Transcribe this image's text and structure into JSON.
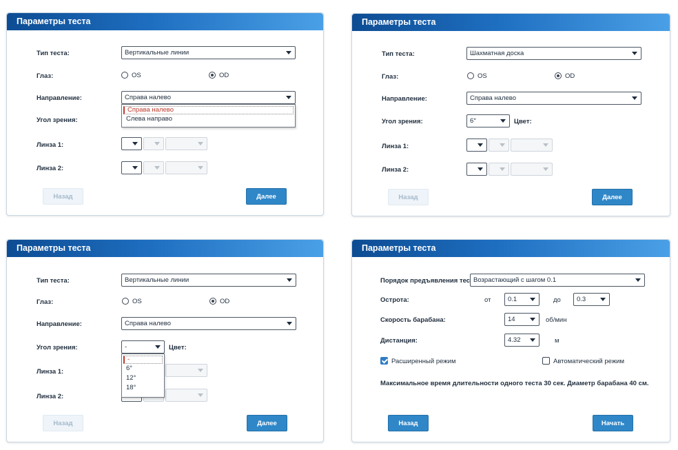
{
  "panel1": {
    "title": "Параметры теста",
    "test_type_label": "Тип теста:",
    "test_type_value": "Вертикальные линии",
    "eye_label": "Глаз:",
    "eye_os": "OS",
    "eye_od": "OD",
    "eye_selected": "OD",
    "direction_label": "Направление:",
    "direction_value": "Справа налево",
    "direction_options": [
      "Справа налево",
      "Слева направо"
    ],
    "angle_label": "Угол зрения:",
    "lens1_label": "Линза 1:",
    "lens2_label": "Линза 2:",
    "back_label": "Назад",
    "next_label": "Далее"
  },
  "panel2": {
    "title": "Параметры теста",
    "test_type_label": "Тип теста:",
    "test_type_value": "Шахматная доска",
    "eye_label": "Глаз:",
    "eye_os": "OS",
    "eye_od": "OD",
    "eye_selected": "OD",
    "direction_label": "Направление:",
    "direction_value": "Справа налево",
    "angle_label": "Угол зрения:",
    "angle_value": "6°",
    "color_label": "Цвет:",
    "lens1_label": "Линза 1:",
    "lens2_label": "Линза 2:",
    "back_label": "Назад",
    "next_label": "Далее"
  },
  "panel3": {
    "title": "Параметры теста",
    "test_type_label": "Тип теста:",
    "test_type_value": "Вертикальные линии",
    "eye_label": "Глаз:",
    "eye_os": "OS",
    "eye_od": "OD",
    "eye_selected": "OD",
    "direction_label": "Направление:",
    "direction_value": "Справа налево",
    "angle_label": "Угол зрения:",
    "angle_value": "-",
    "angle_options": [
      "-",
      "6°",
      "12°",
      "18°"
    ],
    "color_label": "Цвет:",
    "lens1_label": "Линза 1:",
    "lens2_label": "Линза 2:",
    "back_label": "Назад",
    "next_label": "Далее"
  },
  "panel4": {
    "title": "Параметры теста",
    "order_label": "Порядок предъявления теста:",
    "order_value": "Возрастающий с шагом 0.1",
    "acuity_label": "Острота:",
    "from_label": "от",
    "from_value": "0.1",
    "to_label": "до",
    "to_value": "0.3",
    "drum_speed_label": "Скорость барабана:",
    "drum_speed_value": "14",
    "drum_speed_unit": "об/мин",
    "distance_label": "Дистанция:",
    "distance_value": "4.32",
    "distance_unit": "м",
    "extended_mode_label": "Расширенный режим",
    "extended_mode_checked": true,
    "auto_mode_label": "Автоматический режим",
    "auto_mode_checked": false,
    "info_text": "Максимальное время длительности одного теста 30 сек. Диаметр барабана 40 см.",
    "back_label": "Назад",
    "start_label": "Начать"
  }
}
